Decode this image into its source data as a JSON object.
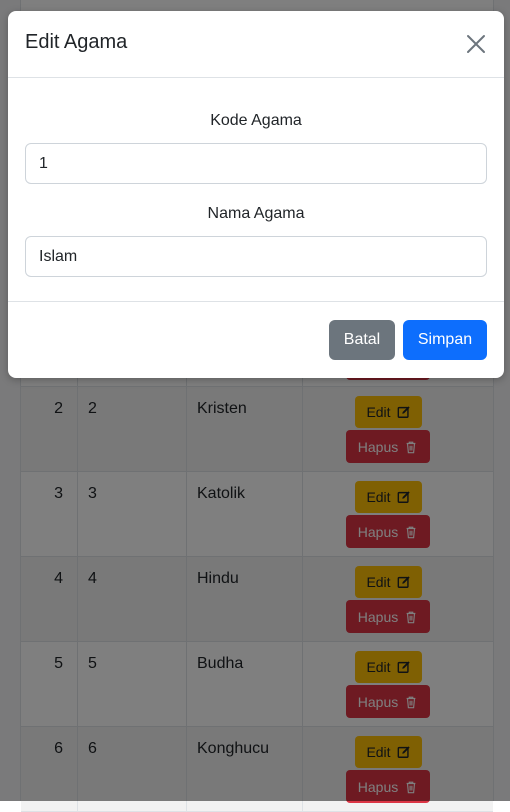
{
  "modal": {
    "title": "Edit Agama",
    "fields": [
      {
        "label": "Kode Agama",
        "value": "1"
      },
      {
        "label": "Nama Agama",
        "value": "Islam"
      }
    ],
    "buttons": {
      "cancel": "Batal",
      "save": "Simpan"
    }
  },
  "table": {
    "rows": [
      {
        "no": "2",
        "kode": "2",
        "nama": "Kristen"
      },
      {
        "no": "3",
        "kode": "3",
        "nama": "Katolik"
      },
      {
        "no": "4",
        "kode": "4",
        "nama": "Hindu"
      },
      {
        "no": "5",
        "kode": "5",
        "nama": "Budha"
      },
      {
        "no": "6",
        "kode": "6",
        "nama": "Konghucu"
      }
    ],
    "actions": {
      "edit_label": "Edit",
      "delete_label": "Hapus"
    }
  },
  "colors": {
    "primary": "#0d6efd",
    "secondary": "#6c757d",
    "warning": "#ffc107",
    "danger": "#dc3545"
  },
  "icons": {
    "close": "close-icon",
    "edit": "pencil-square-icon",
    "delete": "trash-icon"
  }
}
